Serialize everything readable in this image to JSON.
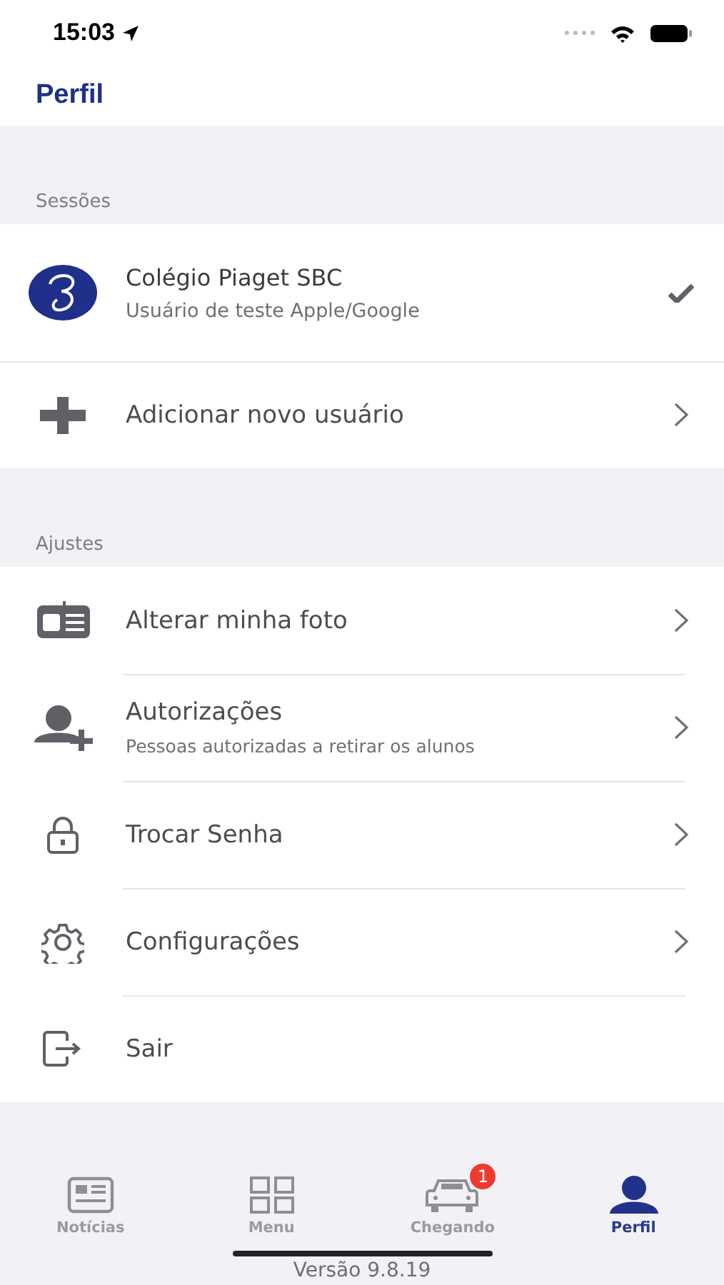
{
  "status_bar": {
    "time": "15:03"
  },
  "header": {
    "title": "Perfil"
  },
  "sections": [
    {
      "title": "Sessões",
      "items": [
        {
          "kind": "session",
          "title": "Colégio Piaget SBC",
          "subtitle": "Usuário de teste Apple/Google",
          "checked": true
        },
        {
          "kind": "link",
          "title": "Adicionar novo usuário"
        }
      ]
    },
    {
      "title": "Ajustes",
      "items": [
        {
          "kind": "link",
          "title": "Alterar minha foto"
        },
        {
          "kind": "link",
          "title": "Autorizações",
          "subtitle": "Pessoas autorizadas a retirar os alunos"
        },
        {
          "kind": "link",
          "title": "Trocar Senha"
        },
        {
          "kind": "link",
          "title": "Configurações"
        },
        {
          "kind": "action",
          "title": "Sair"
        }
      ]
    }
  ],
  "tab_bar": [
    {
      "label": "Notícias",
      "selected": false
    },
    {
      "label": "Menu",
      "selected": false
    },
    {
      "label": "Chegando",
      "selected": false,
      "badge": "1"
    },
    {
      "label": "Perfil",
      "selected": true
    }
  ],
  "footer": {
    "version": "Versão 9.8.19"
  }
}
